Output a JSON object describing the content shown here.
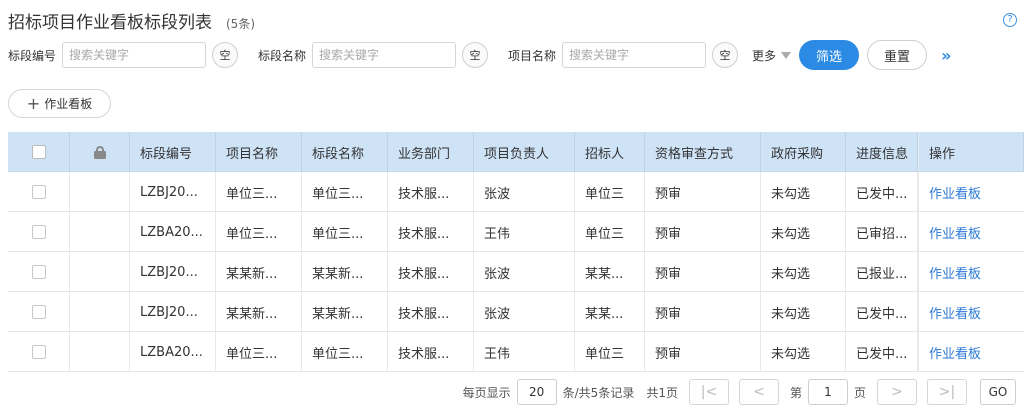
{
  "page": {
    "title": "招标项目作业看板标段列表",
    "count": "(5条)",
    "help_icon": "?"
  },
  "filters": [
    {
      "label": "标段编号",
      "placeholder": "搜索关键字",
      "empty_label": "空"
    },
    {
      "label": "标段名称",
      "placeholder": "搜索关键字",
      "empty_label": "空"
    },
    {
      "label": "项目名称",
      "placeholder": "搜索关键字",
      "empty_label": "空"
    }
  ],
  "toolbar": {
    "more_label": "更多",
    "filter_label": "筛选",
    "reset_label": "重置",
    "expand_icon": "»",
    "add_label": "作业看板",
    "add_icon": "+"
  },
  "table": {
    "headers": [
      "标段编号",
      "项目名称",
      "标段名称",
      "业务部门",
      "项目负责人",
      "招标人",
      "资格审查方式",
      "政府采购",
      "进度信息",
      "操作"
    ],
    "rows": [
      [
        "LZBJ20...",
        "单位三...",
        "单位三...",
        "技术服...",
        "张波",
        "单位三",
        "预审",
        "未勾选",
        "已发中...",
        "作业看板"
      ],
      [
        "LZBA20...",
        "单位三...",
        "单位三...",
        "技术服...",
        "王伟",
        "单位三",
        "预审",
        "未勾选",
        "已审招...",
        "作业看板"
      ],
      [
        "LZBJ20...",
        "某某新...",
        "某某新...",
        "技术服...",
        "张波",
        "某某...",
        "预审",
        "未勾选",
        "已报业...",
        "作业看板"
      ],
      [
        "LZBJ20...",
        "某某新...",
        "某某新...",
        "技术服...",
        "张波",
        "某某...",
        "预审",
        "未勾选",
        "已发中...",
        "作业看板"
      ],
      [
        "LZBA20...",
        "单位三...",
        "单位三...",
        "技术服...",
        "王伟",
        "单位三",
        "预审",
        "未勾选",
        "已发中...",
        "作业看板"
      ]
    ]
  },
  "pager": {
    "per_page_label": "每页显示",
    "per_page_value": "20",
    "total_label": "条/共5条记录",
    "pages_label": "共1页",
    "first_icon": "|<",
    "prev_icon": "<",
    "page_prefix": "第",
    "page_value": "1",
    "page_suffix": "页",
    "next_icon": ">",
    "last_icon": ">|",
    "go_label": "GO"
  },
  "colors": {
    "accent": "#2b8be4",
    "header_bg": "#cfe3f7",
    "link": "#2b7ad6"
  }
}
